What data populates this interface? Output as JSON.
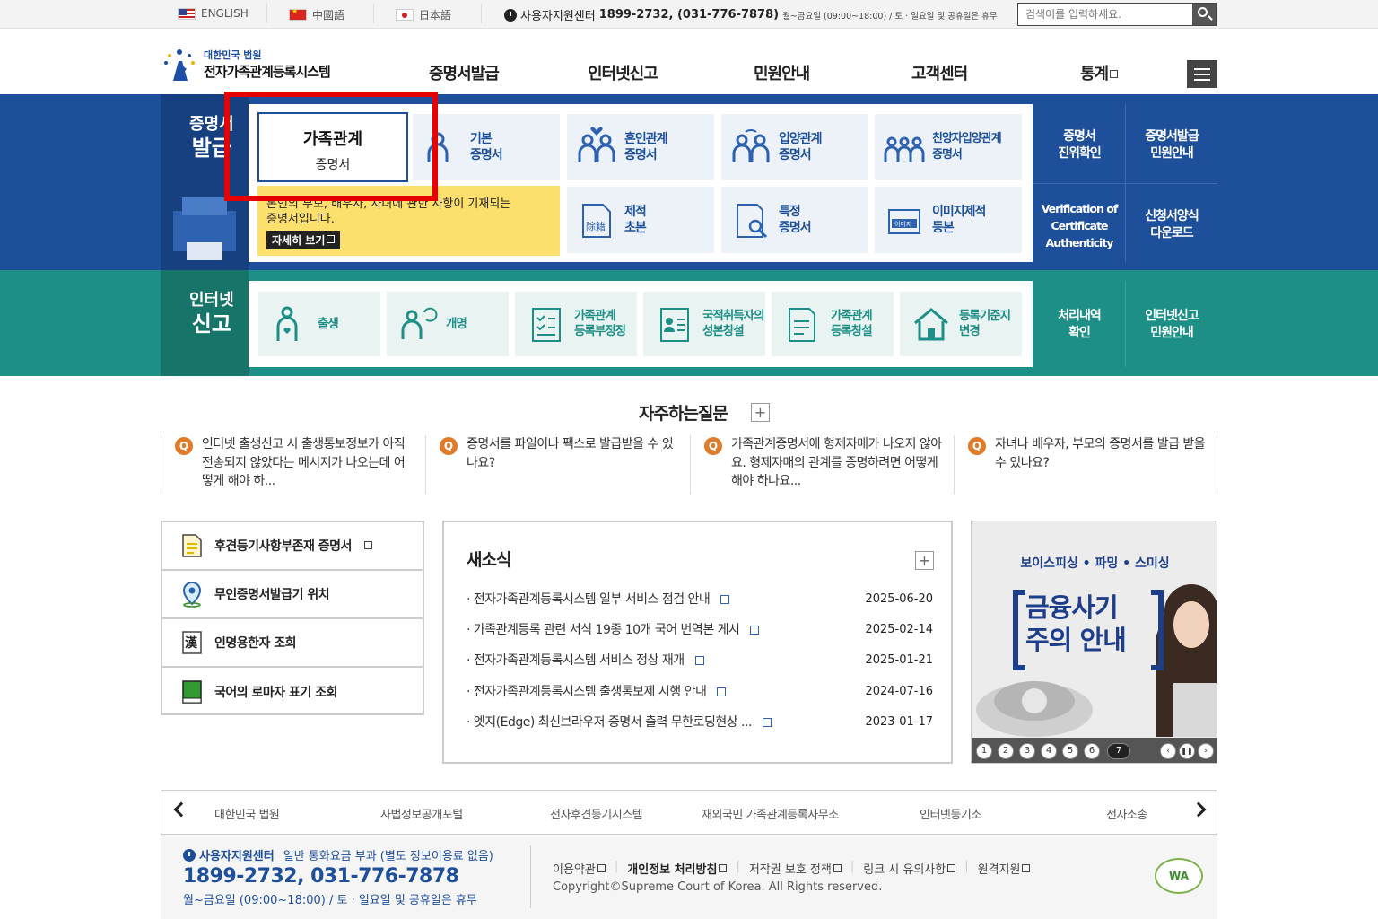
{
  "topbar": {
    "langs": [
      {
        "label": "ENGLISH",
        "icon": "us-flag-icon"
      },
      {
        "label": "中國語",
        "icon": "china-flag-icon"
      },
      {
        "label": "日本語",
        "icon": "japan-flag-icon"
      }
    ],
    "support_label": "사용자지원센터",
    "support_phone": "1899-2732, (031-776-7878)",
    "support_hours": "월~금요일 (09:00~18:00) / 토 · 일요일 및 공휴일은 휴무",
    "search_placeholder": "검색어를 입력하세요."
  },
  "header": {
    "logo_small": "대한민국 법원",
    "logo_title": "전자가족관계등록시스템",
    "nav": [
      "증명서발급",
      "인터넷신고",
      "민원안내",
      "고객센터",
      "통계"
    ]
  },
  "issue": {
    "title_line1": "증명서",
    "title_line2": "발급",
    "selected": {
      "line1": "가족관계",
      "line2": "증명서"
    },
    "tooltip_text1": "본인의 부모, 배우자, 자녀에 관한 사항이 기재되는",
    "tooltip_text2": "증명서입니다.",
    "tooltip_button": "자세히 보기",
    "tiles": [
      {
        "line1": "기본",
        "line2": "증명서"
      },
      {
        "line1": "혼인관계",
        "line2": "증명서"
      },
      {
        "line1": "입양관계",
        "line2": "증명서"
      },
      {
        "line1": "친양자입양관계",
        "line2": "증명서"
      },
      {
        "line1": "제적",
        "line2": "초본"
      },
      {
        "line1": "특정",
        "line2": "증명서"
      },
      {
        "line1": "이미지제적",
        "line2": "등본"
      }
    ],
    "side": [
      {
        "line1": "증명서",
        "line2": "진위확인"
      },
      {
        "line1": "증명서발급",
        "line2": "민원안내"
      },
      {
        "line1": "Verification of",
        "line2": "Certificate",
        "line3": "Authenticity"
      },
      {
        "line1": "신청서양식",
        "line2": "다운로드"
      }
    ]
  },
  "report": {
    "title_line1": "인터넷",
    "title_line2": "신고",
    "tiles": [
      {
        "line1": "출생",
        "line2": ""
      },
      {
        "line1": "개명",
        "line2": ""
      },
      {
        "line1": "가족관계",
        "line2": "등록부정정"
      },
      {
        "line1": "국적취득자의",
        "line2": "성본창설"
      },
      {
        "line1": "가족관계",
        "line2": "등록창설"
      },
      {
        "line1": "등록기준지",
        "line2": "변경"
      }
    ],
    "side": [
      {
        "line1": "처리내역",
        "line2": "확인"
      },
      {
        "line1": "인터넷신고",
        "line2": "민원안내"
      }
    ]
  },
  "faq": {
    "title": "자주하는질문",
    "items": [
      {
        "text": "인터넷 출생신고 시 출생통보정보가 아직 전송되지 않았다는 메시지가 나오는데 어떻게 해야 하..."
      },
      {
        "text": "증명서를 파일이나 팩스로 발급받을 수 있나요?"
      },
      {
        "text": "가족관계증명서에 형제자매가 나오지 않아요. 형제자매의 관계를 증명하려면 어떻게 해야 하나요..."
      },
      {
        "text": "자녀나 배우자, 부모의 증명서를 발급 받을 수 있나요?"
      }
    ]
  },
  "quick_links": [
    {
      "label": "후견등기사항부존재 증명서",
      "icon": "document-icon"
    },
    {
      "label": "무인증명서발급기 위치",
      "icon": "location-pin-icon"
    },
    {
      "label": "인명용한자 조회",
      "icon": "hanja-book-icon"
    },
    {
      "label": "국어의 로마자 표기 조회",
      "icon": "green-book-icon"
    }
  ],
  "news": {
    "title": "새소식",
    "items": [
      {
        "text": "전자가족관계등록시스템 일부 서비스 점검 안내",
        "date": "2025-06-20"
      },
      {
        "text": "가족관계등록 관련 서식 19종 10개 국어 번역본 게시",
        "date": "2025-02-14"
      },
      {
        "text": "전자가족관계등록시스템 서비스 정상 재개",
        "date": "2025-01-21"
      },
      {
        "text": "전자가족관계등록시스템 출생통보제 시행 안내",
        "date": "2024-07-16"
      },
      {
        "text": "엣지(Edge) 최신브라우저 증명서 출력 무한로딩현상 ...",
        "date": "2023-01-17"
      }
    ]
  },
  "banner": {
    "top": "보이스피싱 • 파밍 • 스미싱",
    "line1": "금융사기",
    "line2": "주의 안내",
    "pages": [
      "1",
      "2",
      "3",
      "4",
      "5",
      "6",
      "7"
    ],
    "current_page": "7"
  },
  "family_sites": [
    "대한민국 법원",
    "사법정보공개포털",
    "전자후견등기시스템",
    "재외국민 가족관계등록사무소",
    "인터넷등기소",
    "전자소송"
  ],
  "footer": {
    "support_label": "사용자지원센터",
    "support_note": "일반 통화요금 부과 (별도 정보이용료 없음)",
    "phone": "1899-2732, 031-776-7878",
    "hours": "월~금요일 (09:00~18:00) / 토 · 일요일 및 공휴일은 휴무",
    "links": [
      "이용약관",
      "개인정보 처리방침",
      "저작권 보호 정책",
      "링크 시 유의사항",
      "원격지원"
    ],
    "copyright": "Copyright©Supreme Court of Korea. All Rights reserved.",
    "wa_mark": "WA"
  }
}
